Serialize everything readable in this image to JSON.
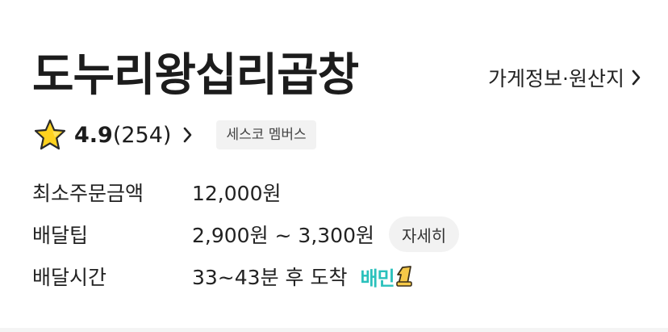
{
  "store": {
    "name": "도누리왕십리곱창",
    "info_link_label": "가게정보·원산지"
  },
  "rating": {
    "score": "4.9",
    "count": "(254)",
    "icon": "star-icon"
  },
  "membership_badge": "세스코 멤버스",
  "info": {
    "min_order_label": "최소주문금액",
    "min_order_value": "12,000원",
    "tip_label": "배달팁",
    "tip_value": "2,900원 ~ 3,300원",
    "tip_detail_button": "자세히",
    "time_label": "배달시간",
    "time_value": "33~43분 후 도착",
    "delivery_brand": "배민",
    "delivery_brand_suffix": "1"
  },
  "colors": {
    "brand_teal": "#2ac1bc",
    "star_fill": "#ffd21f",
    "badge_bg": "#f2f2f2"
  }
}
